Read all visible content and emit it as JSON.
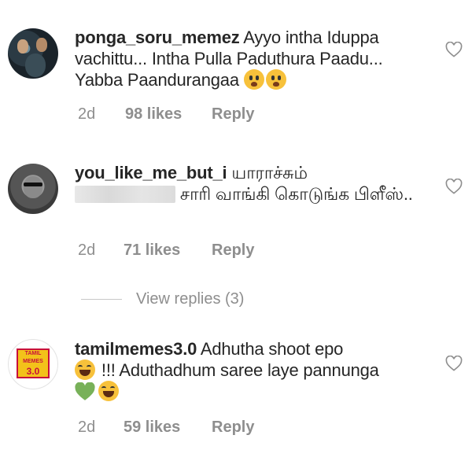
{
  "comments": [
    {
      "username": "ponga_soru_memez",
      "text": " Ayyo intha Iduppa vachittu... Intha Pulla Paduthura Paadu... Yabba Paandurangaa",
      "emojis": [
        "worried-face",
        "worried-face"
      ],
      "time": "2d",
      "likes": "98 likes",
      "reply": "Reply"
    },
    {
      "username": "you_like_me_but_i",
      "text_before": " யாராச்சும்",
      "text_after": " சாரி வாங்கி கொடுங்க பிளீஸ்..",
      "redacted": true,
      "time": "2d",
      "likes": "71 likes",
      "reply": "Reply"
    },
    {
      "username": "tamilmemes3.0",
      "text_1": " Adhutha shoot epo",
      "text_2": " !!! Aduthadhum saree laye pannunga",
      "emojis": [
        "grinning-sweat-face",
        "green-heart",
        "grinning-sweat-face"
      ],
      "time": "2d",
      "likes": "59 likes",
      "reply": "Reply",
      "avatar_logo": {
        "top": "TAMIL MEMES",
        "main": "3.0"
      }
    }
  ],
  "view_replies": "View replies (3)",
  "colors": {
    "text": "#262626",
    "meta": "#8e8e8e",
    "logo_red": "#c8103b",
    "logo_yellow": "#f3c21a",
    "green_heart": "#78b159"
  }
}
